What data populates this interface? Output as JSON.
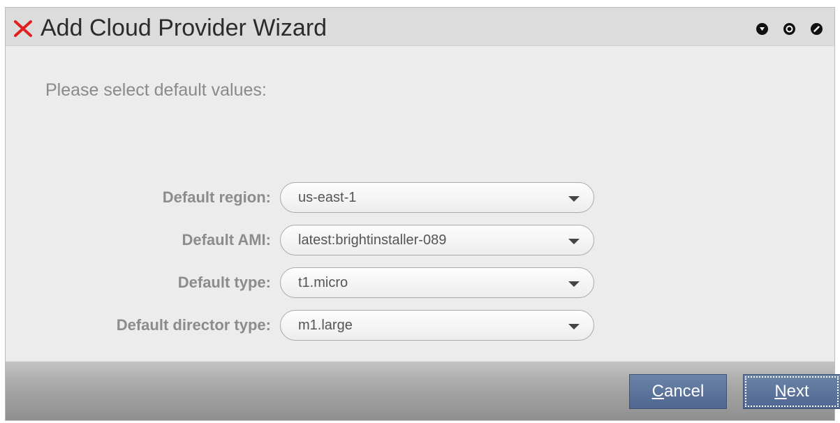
{
  "window": {
    "title": "Add Cloud Provider Wizard",
    "app_icon": "red-x-icon",
    "controls": [
      "minimize-icon",
      "maximize-icon",
      "close-icon"
    ]
  },
  "prompt": "Please select default values:",
  "fields": [
    {
      "label": "Default region:",
      "value": "us-east-1"
    },
    {
      "label": "Default AMI:",
      "value": "latest:brightinstaller-089"
    },
    {
      "label": "Default type:",
      "value": "t1.micro"
    },
    {
      "label": "Default director type:",
      "value": "m1.large"
    }
  ],
  "buttons": {
    "cancel": {
      "mnemonic": "C",
      "rest": "ancel"
    },
    "next": {
      "mnemonic": "N",
      "rest": "ext"
    }
  },
  "colors": {
    "icon_red": "#e02020",
    "button_blue": "#5a729b"
  }
}
